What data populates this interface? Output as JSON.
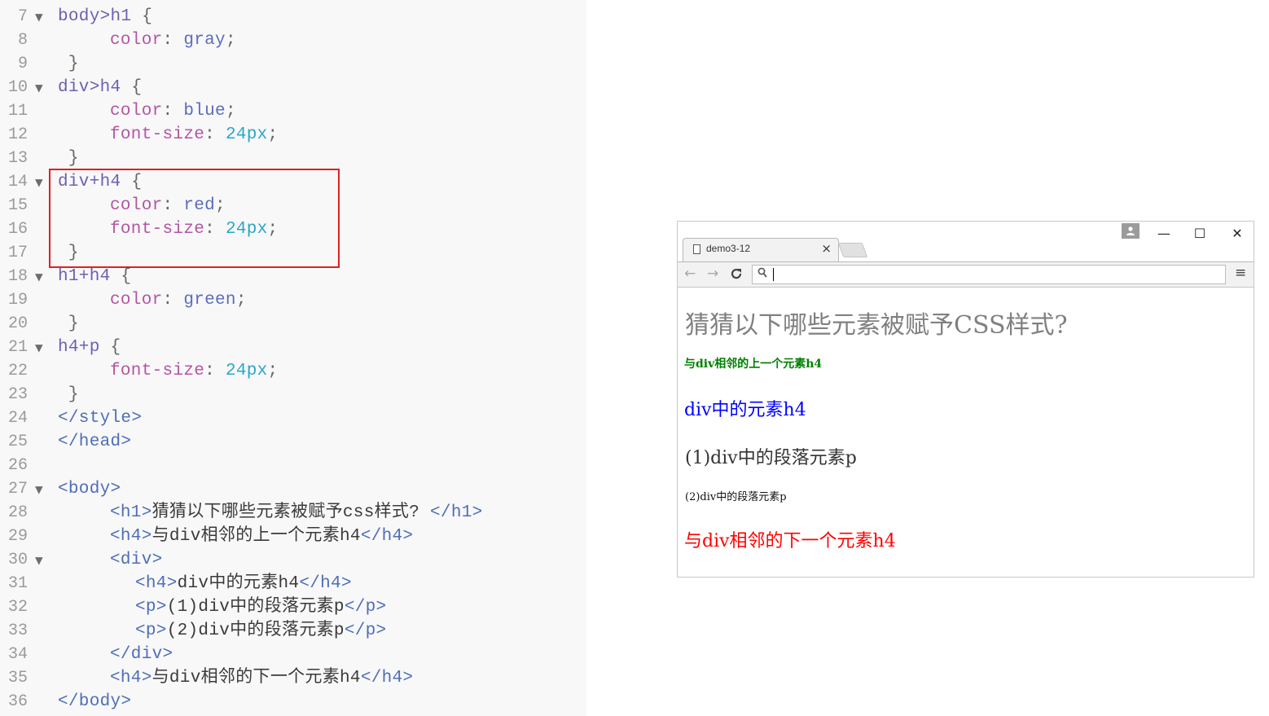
{
  "editor": {
    "lines": [
      {
        "n": "7",
        "fold": true,
        "parts": [
          {
            "t": "body>h1 ",
            "c": "sel"
          },
          {
            "t": "{",
            "c": "punc"
          }
        ]
      },
      {
        "n": "8",
        "fold": false,
        "indent": 1,
        "parts": [
          {
            "t": "color",
            "c": "prop"
          },
          {
            "t": ": ",
            "c": "punc"
          },
          {
            "t": "gray",
            "c": "val"
          },
          {
            "t": ";",
            "c": "punc"
          }
        ]
      },
      {
        "n": "9",
        "fold": false,
        "parts": [
          {
            "t": " }",
            "c": "punc"
          }
        ]
      },
      {
        "n": "10",
        "fold": true,
        "parts": [
          {
            "t": "div>h4 ",
            "c": "sel"
          },
          {
            "t": "{",
            "c": "punc"
          }
        ]
      },
      {
        "n": "11",
        "fold": false,
        "indent": 1,
        "parts": [
          {
            "t": "color",
            "c": "prop"
          },
          {
            "t": ": ",
            "c": "punc"
          },
          {
            "t": "blue",
            "c": "val"
          },
          {
            "t": ";",
            "c": "punc"
          }
        ]
      },
      {
        "n": "12",
        "fold": false,
        "indent": 1,
        "parts": [
          {
            "t": "font-size",
            "c": "prop"
          },
          {
            "t": ": ",
            "c": "punc"
          },
          {
            "t": "24px",
            "c": "num"
          },
          {
            "t": ";",
            "c": "punc"
          }
        ]
      },
      {
        "n": "13",
        "fold": false,
        "parts": [
          {
            "t": " }",
            "c": "punc"
          }
        ]
      },
      {
        "n": "14",
        "fold": true,
        "parts": [
          {
            "t": "div+h4 ",
            "c": "sel"
          },
          {
            "t": "{",
            "c": "punc"
          }
        ]
      },
      {
        "n": "15",
        "fold": false,
        "indent": 1,
        "parts": [
          {
            "t": "color",
            "c": "prop"
          },
          {
            "t": ": ",
            "c": "punc"
          },
          {
            "t": "red",
            "c": "val"
          },
          {
            "t": ";",
            "c": "punc"
          }
        ]
      },
      {
        "n": "16",
        "fold": false,
        "indent": 1,
        "parts": [
          {
            "t": "font-size",
            "c": "prop"
          },
          {
            "t": ": ",
            "c": "punc"
          },
          {
            "t": "24px",
            "c": "num"
          },
          {
            "t": ";",
            "c": "punc"
          }
        ]
      },
      {
        "n": "17",
        "fold": false,
        "parts": [
          {
            "t": " }",
            "c": "punc"
          }
        ]
      },
      {
        "n": "18",
        "fold": true,
        "parts": [
          {
            "t": "h1+h4 ",
            "c": "sel"
          },
          {
            "t": "{",
            "c": "punc"
          }
        ]
      },
      {
        "n": "19",
        "fold": false,
        "indent": 1,
        "parts": [
          {
            "t": "color",
            "c": "prop"
          },
          {
            "t": ": ",
            "c": "punc"
          },
          {
            "t": "green",
            "c": "val"
          },
          {
            "t": ";",
            "c": "punc"
          }
        ]
      },
      {
        "n": "20",
        "fold": false,
        "parts": [
          {
            "t": " }",
            "c": "punc"
          }
        ]
      },
      {
        "n": "21",
        "fold": true,
        "parts": [
          {
            "t": "h4+p ",
            "c": "sel"
          },
          {
            "t": "{",
            "c": "punc"
          }
        ]
      },
      {
        "n": "22",
        "fold": false,
        "indent": 1,
        "parts": [
          {
            "t": "font-size",
            "c": "prop"
          },
          {
            "t": ": ",
            "c": "punc"
          },
          {
            "t": "24px",
            "c": "num"
          },
          {
            "t": ";",
            "c": "punc"
          }
        ]
      },
      {
        "n": "23",
        "fold": false,
        "parts": [
          {
            "t": " }",
            "c": "punc"
          }
        ]
      },
      {
        "n": "24",
        "fold": false,
        "parts": [
          {
            "t": "</style>",
            "c": "tag"
          }
        ]
      },
      {
        "n": "25",
        "fold": false,
        "parts": [
          {
            "t": "</head>",
            "c": "tag"
          }
        ]
      },
      {
        "n": "26",
        "fold": false,
        "parts": []
      },
      {
        "n": "27",
        "fold": true,
        "parts": [
          {
            "t": "<body>",
            "c": "tag"
          }
        ]
      },
      {
        "n": "28",
        "fold": false,
        "indent": 1,
        "parts": [
          {
            "t": "<h1>",
            "c": "tag"
          },
          {
            "t": "猜猜以下哪些元素被赋予css样式? ",
            "c": "text"
          },
          {
            "t": "</h1>",
            "c": "tag"
          }
        ]
      },
      {
        "n": "29",
        "fold": false,
        "indent": 1,
        "parts": [
          {
            "t": "<h4>",
            "c": "tag"
          },
          {
            "t": "与div相邻的上一个元素h4",
            "c": "text"
          },
          {
            "t": "</h4>",
            "c": "tag"
          }
        ]
      },
      {
        "n": "30",
        "fold": true,
        "indent": 1,
        "parts": [
          {
            "t": "<div>",
            "c": "tag"
          }
        ]
      },
      {
        "n": "31",
        "fold": false,
        "indent": 2,
        "parts": [
          {
            "t": "<h4>",
            "c": "tag"
          },
          {
            "t": "div中的元素h4",
            "c": "text"
          },
          {
            "t": "</h4>",
            "c": "tag"
          }
        ]
      },
      {
        "n": "32",
        "fold": false,
        "indent": 2,
        "parts": [
          {
            "t": "<p>",
            "c": "tag"
          },
          {
            "t": "(1)div中的段落元素p",
            "c": "text"
          },
          {
            "t": "</p>",
            "c": "tag"
          }
        ]
      },
      {
        "n": "33",
        "fold": false,
        "indent": 2,
        "parts": [
          {
            "t": "<p>",
            "c": "tag"
          },
          {
            "t": "(2)div中的段落元素p",
            "c": "text"
          },
          {
            "t": "</p>",
            "c": "tag"
          }
        ]
      },
      {
        "n": "34",
        "fold": false,
        "indent": 1,
        "parts": [
          {
            "t": "</div>",
            "c": "tag"
          }
        ]
      },
      {
        "n": "35",
        "fold": false,
        "indent": 1,
        "parts": [
          {
            "t": "<h4>",
            "c": "tag"
          },
          {
            "t": "与div相邻的下一个元素h4",
            "c": "text"
          },
          {
            "t": "</h4>",
            "c": "tag"
          }
        ]
      },
      {
        "n": "36",
        "fold": false,
        "parts": [
          {
            "t": "</body>",
            "c": "tag"
          }
        ]
      }
    ],
    "fold_glyph": "▼",
    "highlight_color": "#e02020"
  },
  "browser": {
    "tab_title": "demo3-12",
    "tab_close": "×",
    "user_icon": "user-icon",
    "win_min": "—",
    "win_max": "☐",
    "win_close": "✕",
    "back": "←",
    "forward": "→",
    "reload": "C",
    "search_glyph": "⚲",
    "menu": "≡",
    "page": {
      "h1": "猜猜以下哪些元素被赋予CSS样式?",
      "h4_green": "与div相邻的上一个元素h4",
      "h4_blue": "div中的元素h4",
      "p1": "(1)div中的段落元素p",
      "p2": "(2)div中的段落元素p",
      "h4_red": "与div相邻的下一个元素h4"
    }
  }
}
